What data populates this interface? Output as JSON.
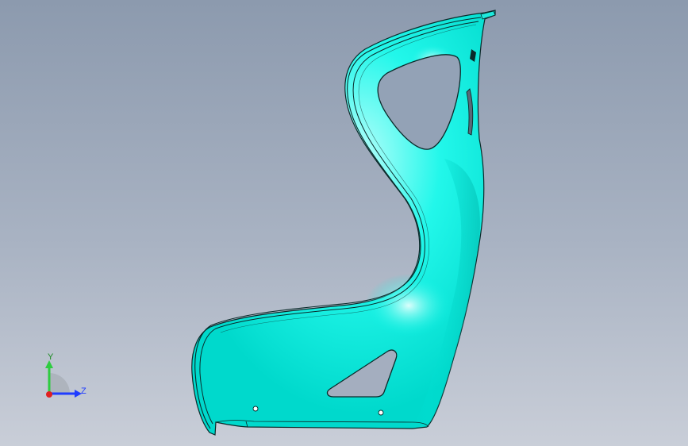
{
  "model": {
    "name": "seat-shell",
    "color": "#00f5e6",
    "edge_color": "#0a2a2a"
  },
  "triad": {
    "y_label": "Y",
    "z_label": "Z",
    "y_color": "#2ecc40",
    "z_color": "#1f3cff",
    "origin_color": "#e02020"
  }
}
